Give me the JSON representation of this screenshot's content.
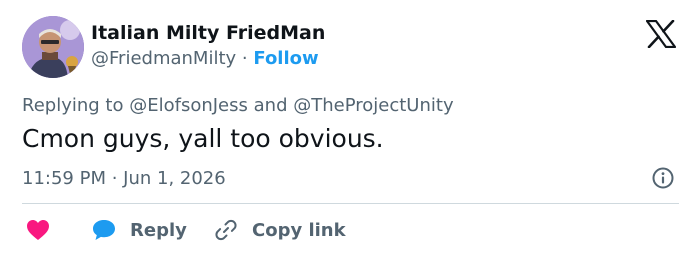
{
  "user": {
    "display_name": "Italian Milty FriedMan",
    "handle": "@FriedmanMilty",
    "separator": "·",
    "follow_label": "Follow"
  },
  "reply_context": {
    "prefix": "Replying to",
    "mention1": "@ElofsonJess",
    "conjunction": "and",
    "mention2": "@TheProjectUnity"
  },
  "tweet": {
    "text": "Cmon guys, yall too obvious.",
    "timestamp": "11:59 PM · Jun 1, 2026"
  },
  "actions": {
    "reply_label": "Reply",
    "copy_label": "Copy link"
  },
  "icons": {
    "platform": "x-logo-icon",
    "info": "info-icon",
    "like": "heart-icon",
    "reply": "speech-bubble-icon",
    "copy": "link-icon"
  },
  "colors": {
    "accent": "#1d9bf0",
    "heart": "#f91880",
    "text_primary": "#0f1419",
    "text_secondary": "#536471",
    "divider": "#cfd9de"
  }
}
